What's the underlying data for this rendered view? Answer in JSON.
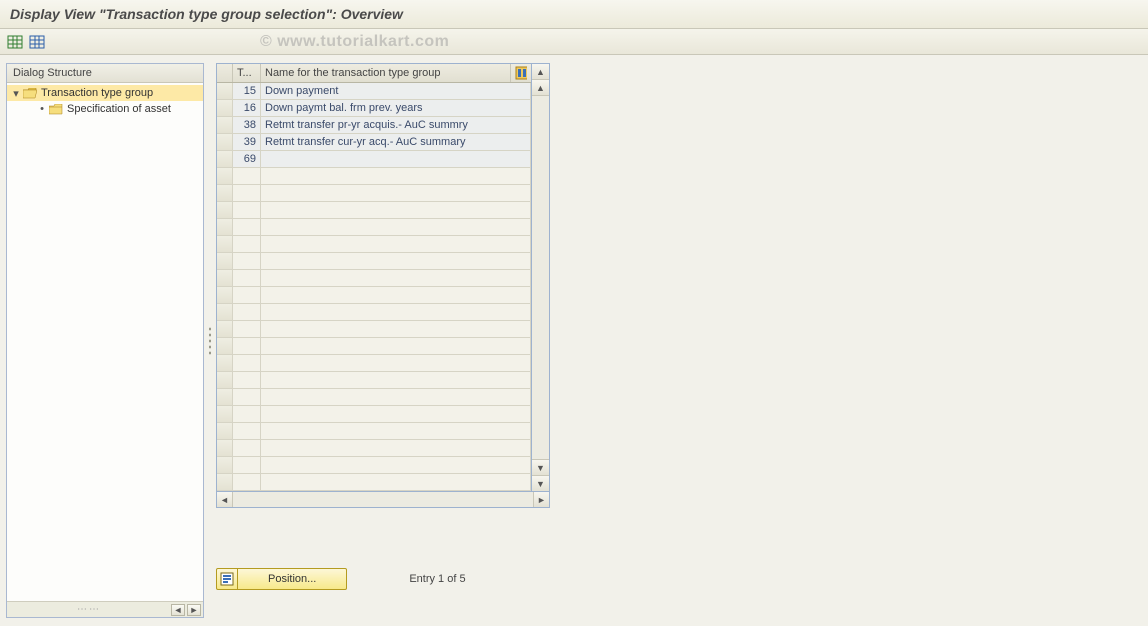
{
  "header": {
    "title": "Display View \"Transaction type group selection\": Overview"
  },
  "watermark": "© www.tutorialkart.com",
  "sidebar": {
    "header": "Dialog Structure",
    "nodes": [
      {
        "label": "Transaction type group",
        "expanded": true,
        "selected": true,
        "kind": "folder-open"
      },
      {
        "label": "Specification of asset",
        "expanded": false,
        "selected": false,
        "kind": "folder-closed",
        "child": true
      }
    ]
  },
  "table": {
    "columns": {
      "code_header": "T...",
      "name_header": "Name for the transaction type group"
    },
    "rows": [
      {
        "code": "15",
        "name": "Down payment"
      },
      {
        "code": "16",
        "name": "Down paymt bal. frm prev. years"
      },
      {
        "code": "38",
        "name": "Retmt transfer pr-yr acquis.- AuC summry"
      },
      {
        "code": "39",
        "name": "Retmt transfer cur-yr acq.- AuC summary"
      },
      {
        "code": "69",
        "name": ""
      }
    ],
    "empty_row_count": 19
  },
  "footer": {
    "position_label": "Position...",
    "status": "Entry 1 of 5"
  }
}
